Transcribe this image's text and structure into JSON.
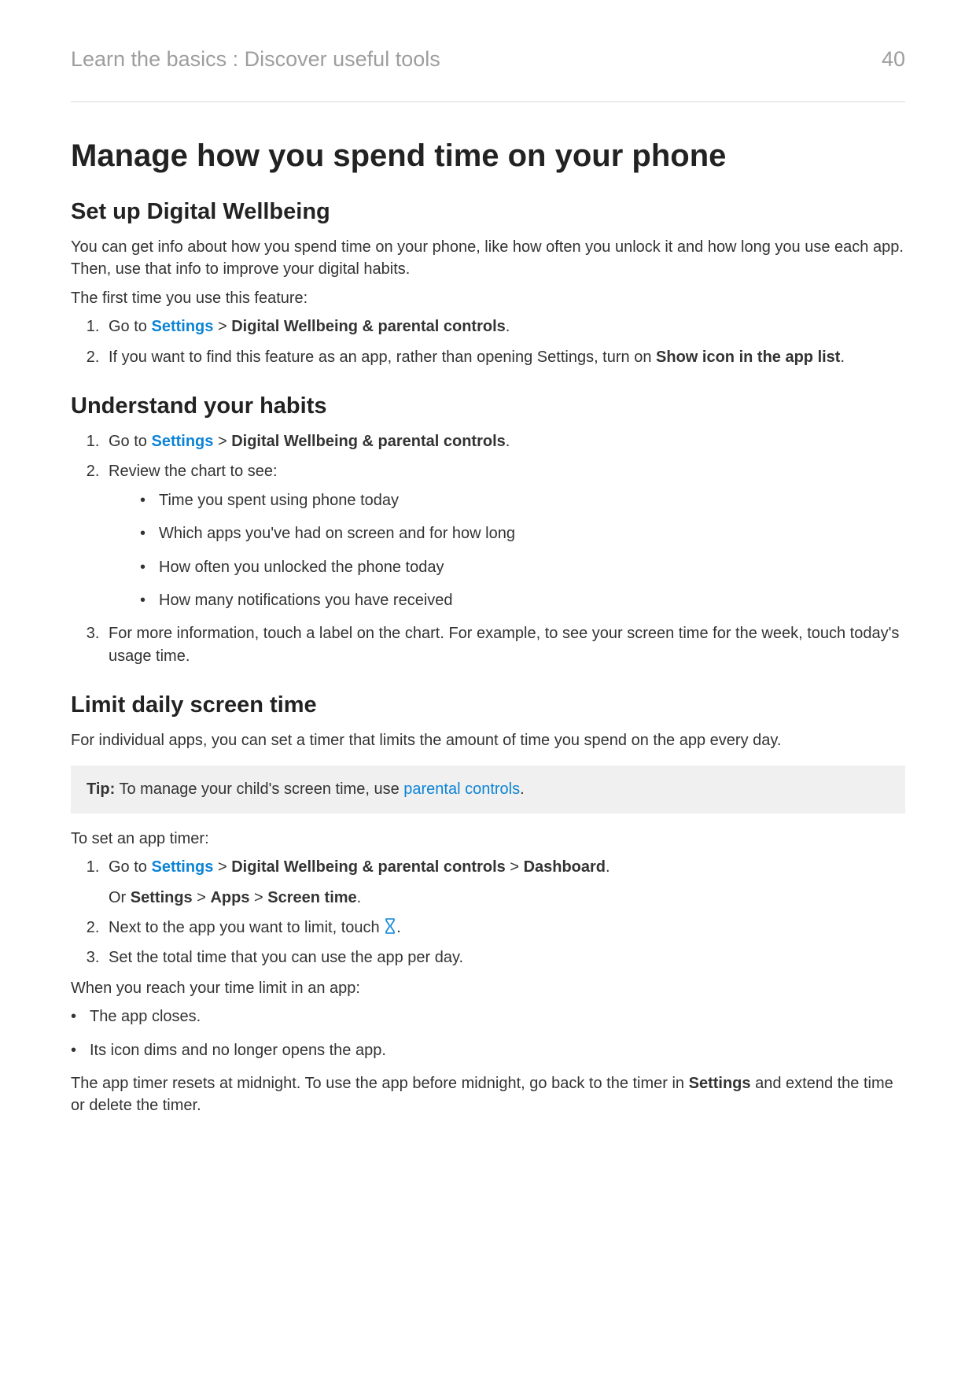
{
  "header": {
    "breadcrumb": "Learn the basics : Discover useful tools",
    "page_number": "40"
  },
  "title": "Manage how you spend time on your phone",
  "section1": {
    "heading": "Set up Digital Wellbeing",
    "para1": "You can get info about how you spend time on your phone, like how often you unlock it and how long you use each app. Then, use that info to improve your digital habits.",
    "para2": "The first time you use this feature:",
    "step1_prefix": "Go to ",
    "settings_link": "Settings",
    "gt": " > ",
    "dw_bold": "Digital Wellbeing & parental controls",
    "period": ".",
    "step2_a": "If you want to find this feature as an app, rather than opening Settings, turn on ",
    "step2_bold": "Show icon in the app list",
    "step2_b": "."
  },
  "section2": {
    "heading": "Understand your habits",
    "step2_intro": "Review the chart to see:",
    "bullet1": "Time you spent using phone today",
    "bullet2": "Which apps you've had on screen and for how long",
    "bullet3": "How often you unlocked the phone today",
    "bullet4": "How many notifications you have received",
    "step3": "For more information, touch a label on the chart. For example, to see your screen time for the week, touch today's usage time."
  },
  "section3": {
    "heading": "Limit daily screen time",
    "para1": "For individual apps, you can set a timer that limits the amount of time you spend on the app every day.",
    "tip_label": "Tip:",
    "tip_text_a": " To manage your child's screen time, use ",
    "tip_link": "parental controls",
    "tip_text_b": ".",
    "para2": "To set an app timer:",
    "step1_dashboard": "Dashboard",
    "step1b_or": "Or ",
    "step1b_settings": "Settings",
    "step1b_apps": "Apps",
    "step1b_screentime": "Screen time",
    "step2_a": "Next to the app you want to limit, touch ",
    "step2_b": ".",
    "step3": "Set the total time that you can use the app per day.",
    "para3": "When you reach your time limit in an app:",
    "limit_bullet1": "The app closes.",
    "limit_bullet2": "Its icon dims and no longer opens the app.",
    "para4_a": "The app timer resets at midnight. To use the app before midnight, go back to the timer in ",
    "para4_bold": "Settings",
    "para4_b": " and extend the time or delete the timer."
  }
}
